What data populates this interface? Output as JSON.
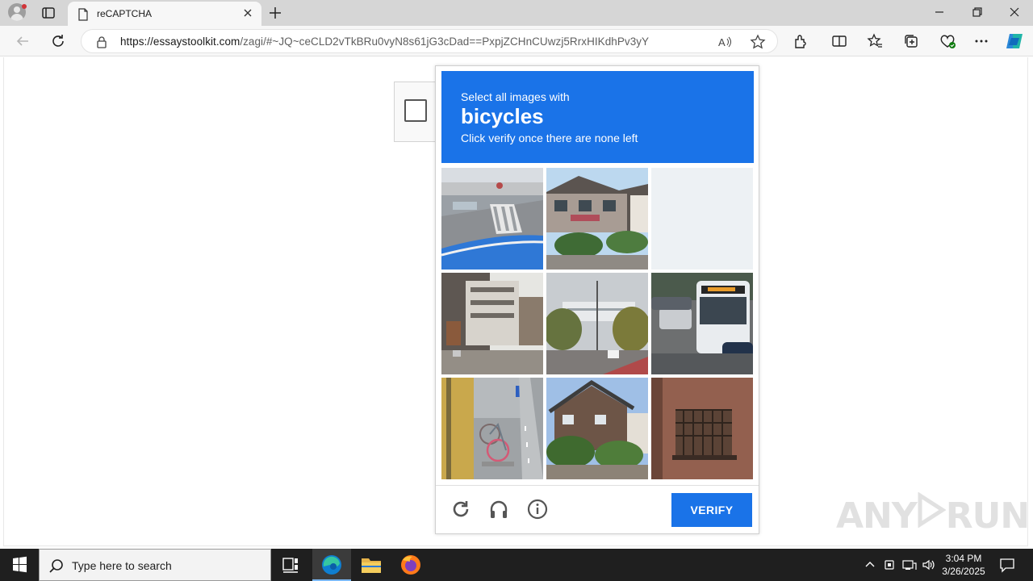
{
  "browser": {
    "tab_title": "reCAPTCHA",
    "url_host": "https://essaystoolkit.com",
    "url_path": "/zagi/#~JQ~ceCLD2vTkBRu0vyN8s61jG3cDad==PxpjZCHnCUwzj5RrxHIKdhPv3yY"
  },
  "captcha": {
    "prompt_line1": "Select all images with",
    "target": "bicycles",
    "prompt_line3": "Click verify once there are none left",
    "verify_label": "VERIFY",
    "tiles": [
      "street-crosswalk",
      "house-street",
      "blank-tile",
      "apartment-building",
      "street-trees",
      "bus-traffic",
      "bicycle-parking",
      "house-trees",
      "balcony"
    ]
  },
  "watermark": {
    "left": "ANY",
    "right": "RUN"
  },
  "taskbar": {
    "search_placeholder": "Type here to search",
    "time": "3:04 PM",
    "date": "3/26/2025"
  },
  "colors": {
    "accent": "#1a73e8",
    "taskbar": "#1f1f1f"
  }
}
